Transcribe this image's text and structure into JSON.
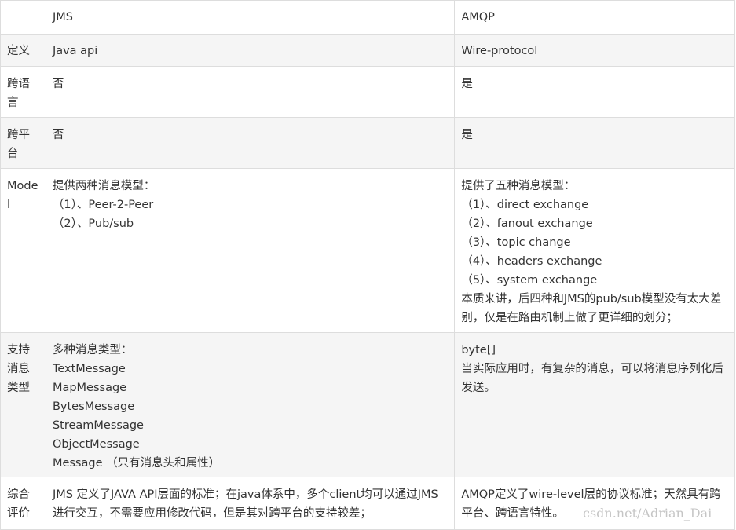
{
  "table": {
    "header": [
      "",
      "JMS",
      "AMQP"
    ],
    "rows": [
      {
        "label": "定义",
        "jms": [
          "Java api"
        ],
        "amqp": [
          "Wire-protocol"
        ]
      },
      {
        "label": "跨语言",
        "jms": [
          "否"
        ],
        "amqp": [
          "是"
        ]
      },
      {
        "label": "跨平台",
        "jms": [
          "否"
        ],
        "amqp": [
          "是"
        ]
      },
      {
        "label": "Model",
        "jms": [
          "提供两种消息模型：",
          " （1）、Peer-2-Peer",
          " （2）、Pub/sub"
        ],
        "amqp": [
          "提供了五种消息模型：",
          " （1）、direct exchange",
          " （2）、fanout exchange",
          " （3）、topic change",
          " （4）、headers exchange",
          " （5）、system exchange",
          "本质来讲，后四种和JMS的pub/sub模型没有太大差别，仅是在路由机制上做了更详细的划分；"
        ]
      },
      {
        "label": "支持消息类型",
        "jms": [
          "多种消息类型：",
          "TextMessage",
          "MapMessage",
          "BytesMessage",
          "StreamMessage",
          "ObjectMessage",
          "Message （只有消息头和属性）"
        ],
        "amqp": [
          "byte[]",
          "当实际应用时，有复杂的消息，可以将消息序列化后发送。"
        ]
      },
      {
        "label": "综合评价",
        "jms": [
          "JMS 定义了JAVA API层面的标准；在java体系中，多个client均可以通过JMS进行交互，不需要应用修改代码，但是其对跨平台的支持较差；"
        ],
        "amqp": [
          "AMQP定义了wire-level层的协议标准；天然具有跨平台、跨语言特性。"
        ]
      }
    ]
  },
  "watermark": "csdn.net/Adrian_Dai"
}
